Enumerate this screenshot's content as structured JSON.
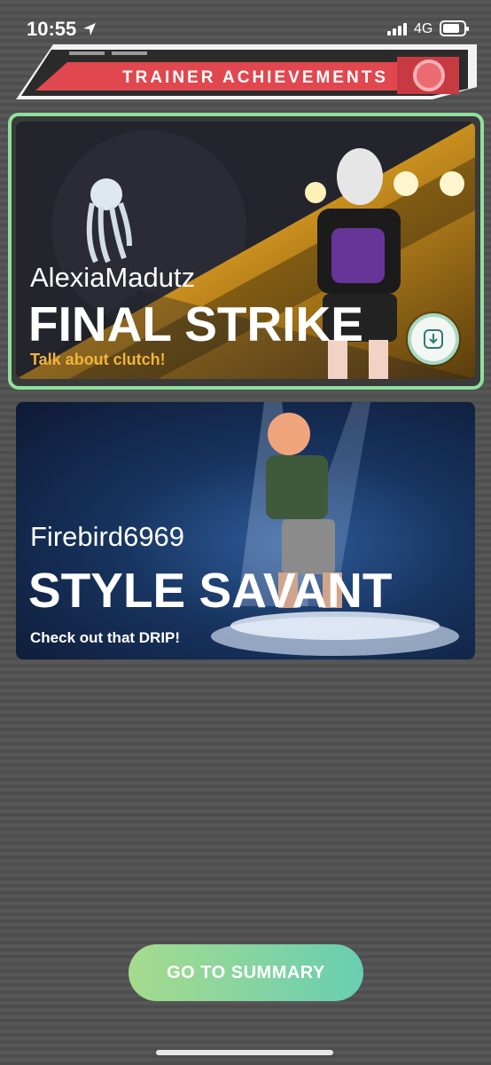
{
  "status_bar": {
    "time": "10:55",
    "network": "4G",
    "icons": [
      "location-arrow-icon",
      "signal-bars-icon",
      "battery-icon"
    ]
  },
  "header": {
    "title": "TRAINER ACHIEVEMENTS"
  },
  "cards": [
    {
      "username": "AlexiaMadutz",
      "title": "FINAL STRIKE",
      "subtitle": "Talk about clutch!",
      "subtitle_color": "#f0b43c",
      "selected": true,
      "has_download": true
    },
    {
      "username": "Firebird6969",
      "title": "STYLE SAVANT",
      "subtitle": "Check out that DRIP!",
      "subtitle_color": "#ffffff",
      "selected": false,
      "has_download": false
    }
  ],
  "footer": {
    "summary_label": "GO TO SUMMARY"
  },
  "colors": {
    "selected_border": "#8fe09d",
    "button_gradient_start": "#a6db8d",
    "button_gradient_end": "#68ceb2",
    "banner_red": "#e0474e"
  }
}
